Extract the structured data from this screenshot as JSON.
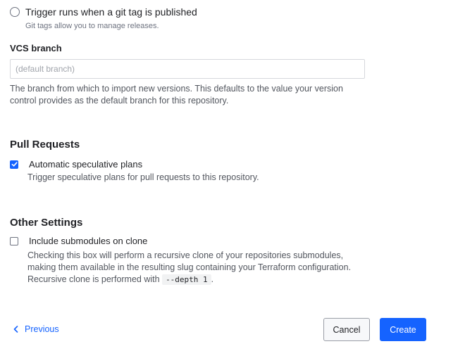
{
  "trigger": {
    "radio_label": "Trigger runs when a git tag is published",
    "radio_help": "Git tags allow you to manage releases.",
    "selected": false
  },
  "vcs_branch": {
    "label": "VCS branch",
    "placeholder": "(default branch)",
    "value": "",
    "help_line1": "The branch from which to import new versions. This defaults to the value your version",
    "help_line2": "control provides as the default branch for this repository."
  },
  "pull_requests": {
    "heading": "Pull Requests",
    "checkbox_label": "Automatic speculative plans",
    "checked": true,
    "help": "Trigger speculative plans for pull requests to this repository."
  },
  "other_settings": {
    "heading": "Other Settings",
    "checkbox_label": "Include submodules on clone",
    "checked": false,
    "help_line1": "Checking this box will perform a recursive clone of your repositories submodules,",
    "help_line2": "making them available in the resulting slug containing your Terraform configuration.",
    "help_line3_prefix": "Recursive clone is performed with",
    "help_line3_code": "--depth 1",
    "help_line3_suffix": "."
  },
  "footer": {
    "previous_label": "Previous",
    "cancel_label": "Cancel",
    "create_label": "Create"
  },
  "colors": {
    "accent": "#1563ff",
    "text": "#1f2024",
    "muted": "#52565e"
  },
  "icons": {
    "previous": "chevron-left-icon",
    "checked": "checkmark-icon"
  }
}
